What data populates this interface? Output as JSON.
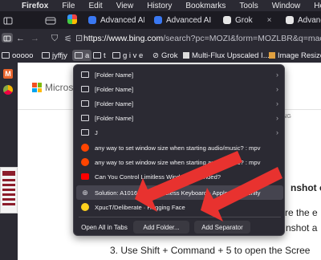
{
  "menubar": {
    "apple": "",
    "app": "Firefox",
    "items": [
      "File",
      "Edit",
      "View",
      "History",
      "Bookmarks",
      "Tools",
      "Window",
      "Help"
    ]
  },
  "tabs": [
    {
      "label": "Advanced AI",
      "close": "×"
    },
    {
      "label": "Advanced AI",
      "close": "×"
    },
    {
      "label": "Grok",
      "close": "×"
    },
    {
      "label": "Advanced",
      "close": ""
    }
  ],
  "url": {
    "host": "https://www.bing.com",
    "path": "/search?pc=MOZI&form=MOZLBR&q=mac"
  },
  "bookmarks_bar": {
    "items": [
      "ooooo",
      "jyffjy",
      "a",
      "t",
      "g i v e",
      "Grok",
      "Multi-Flux Upscaled I...",
      "Image Resizer"
    ]
  },
  "page": {
    "brand": "Microsoft",
    "tab_fragment": "PPING",
    "lines": [
      "nshot o",
      "re the e",
      "nshot a"
    ],
    "step3": "3. Use Shift + Command + 5 to open the Scree"
  },
  "menu": {
    "items": [
      {
        "label": "[Folder Name]",
        "type": "folder",
        "submenu": true
      },
      {
        "label": "[Folder Name]",
        "type": "folder",
        "submenu": true
      },
      {
        "label": "[Folder Name]",
        "type": "folder",
        "submenu": true
      },
      {
        "label": "[Folder Name]",
        "type": "folder",
        "submenu": true
      },
      {
        "label": "J",
        "type": "folder",
        "submenu": true
      },
      {
        "label": "any way to set window size when starting audio/music? : mpv",
        "type": "reddit"
      },
      {
        "label": "any way to set window size when starting audio/music? : mpv",
        "type": "reddit"
      },
      {
        "label": "Can You Control Limitless Windows Rounded?",
        "type": "youtube"
      },
      {
        "label": "Solution: A1016 Apple Wireless Keyboard - Apple Community",
        "type": "globe",
        "highlighted": true
      },
      {
        "label": "XpucT/Deliberate · Hugging Face",
        "type": "hf"
      }
    ],
    "open_all": "Open All in Tabs",
    "add_folder": "Add Folder...",
    "add_separator": "Add Separator"
  },
  "colors": {
    "menu_bg": "#2b2a33",
    "highlight": "#45444f",
    "annotation_arrow": "#e8322f"
  }
}
